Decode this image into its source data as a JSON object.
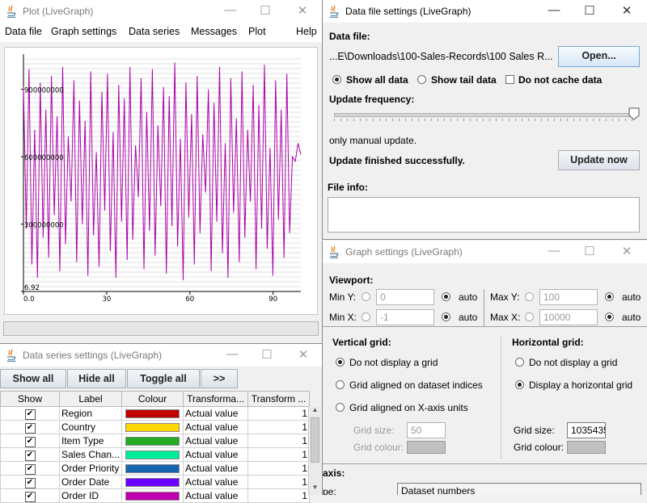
{
  "plot_window": {
    "title": "Plot (LiveGraph)",
    "menu": [
      "Data file",
      "Graph settings",
      "Data series",
      "Messages",
      "Plot",
      "Help"
    ],
    "y_tick_labels": [
      "900000000",
      "600000000",
      "300000000",
      "6.92"
    ],
    "x_tick_labels": [
      "0.0",
      "30",
      "60",
      "90"
    ],
    "line_color": "#aa00aa"
  },
  "chart_data": {
    "type": "line",
    "xlim": [
      0,
      100
    ],
    "ylim": [
      6.92,
      1035435000
    ],
    "y_ticks": [
      900000000,
      600000000,
      300000000,
      6.92
    ],
    "x_ticks": [
      0,
      30,
      60,
      90
    ],
    "grid": "horizontal",
    "series": [
      {
        "values": [
          910000000,
          280000000,
          990000000,
          120000000,
          720000000,
          60000000,
          930000000,
          240000000,
          810000000,
          150000000,
          960000000,
          340000000,
          780000000,
          90000000,
          1000000000,
          210000000,
          690000000,
          400000000,
          940000000,
          130000000,
          850000000,
          300000000,
          760000000,
          70000000,
          980000000,
          250000000,
          620000000,
          110000000,
          890000000,
          360000000,
          970000000,
          180000000,
          710000000,
          60000000,
          920000000,
          310000000,
          860000000,
          140000000,
          1000000000,
          230000000,
          650000000,
          420000000,
          950000000,
          100000000,
          800000000,
          270000000,
          990000000,
          160000000,
          740000000,
          380000000,
          910000000,
          80000000,
          870000000,
          290000000,
          1020000000,
          200000000,
          680000000,
          50000000,
          930000000,
          330000000,
          790000000,
          120000000,
          960000000,
          260000000,
          700000000,
          440000000,
          900000000,
          90000000,
          840000000,
          310000000,
          1000000000,
          170000000,
          660000000,
          60000000,
          950000000,
          350000000,
          770000000,
          130000000,
          980000000,
          240000000,
          720000000,
          400000000,
          920000000,
          100000000,
          830000000,
          280000000,
          1010000000,
          190000000,
          640000000,
          70000000,
          940000000,
          320000000,
          810000000,
          150000000,
          970000000,
          260000000,
          600000000,
          580000000,
          660000000,
          610000000
        ]
      }
    ]
  },
  "data_file_window": {
    "title": "Data file settings (LiveGraph)",
    "data_file_label": "Data file:",
    "file_path": "...E\\Downloads\\100-Sales-Records\\100 Sales R...",
    "open_button": "Open...",
    "show_all": "Show all data",
    "show_tail": "Show tail data",
    "no_cache": "Do not cache data",
    "update_freq_label": "Update frequency:",
    "update_mode": "only manual update.",
    "status": "Update finished successfully.",
    "update_button": "Update now",
    "file_info_label": "File info:",
    "slider_value_fraction": 1.0
  },
  "graph_settings_window": {
    "title": "Graph settings (LiveGraph)",
    "viewport_label": "Viewport:",
    "min_y_label": "Min Y:",
    "min_y_value": "0",
    "max_y_label": "Max Y:",
    "max_y_value": "100",
    "min_x_label": "Min X:",
    "min_x_value": "-1",
    "max_x_label": "Max X:",
    "max_x_value": "10000",
    "auto": "auto",
    "vertical_grid_label": "Vertical grid:",
    "v_opt_none": "Do not display a grid",
    "v_opt_indices": "Grid aligned on dataset indices",
    "v_opt_units": "Grid aligned on X-axis units",
    "v_grid_size_label": "Grid size:",
    "v_grid_size": "50",
    "v_grid_colour_label": "Grid colour:",
    "horizontal_grid_label": "Horizontal grid:",
    "h_opt_none": "Do not display a grid",
    "h_opt_display": "Display a horizontal grid",
    "h_grid_size_label": "Grid size:",
    "h_grid_size": "1035435",
    "h_grid_colour_label": "Grid colour:",
    "x_axis_label": "axis:",
    "x_axis_prefix": "pe:",
    "x_axis_value": "Dataset numbers"
  },
  "data_series_window": {
    "title": "Data series settings (LiveGraph)",
    "buttons": [
      "Show all",
      "Hide all",
      "Toggle all",
      ">>"
    ],
    "columns": [
      "Show",
      "Label",
      "Colour",
      "Transforma...",
      "Transform ..."
    ],
    "rows": [
      {
        "label": "Region",
        "colour": "#c00000",
        "transform": "Actual value",
        "param": "1"
      },
      {
        "label": "Country",
        "colour": "#ffd700",
        "transform": "Actual value",
        "param": "1"
      },
      {
        "label": "Item Type",
        "colour": "#22aa22",
        "transform": "Actual value",
        "param": "1"
      },
      {
        "label": "Sales Chan...",
        "colour": "#00ee99",
        "transform": "Actual value",
        "param": "1"
      },
      {
        "label": "Order Priority",
        "colour": "#1565b0",
        "transform": "Actual value",
        "param": "1"
      },
      {
        "label": "Order Date",
        "colour": "#6a00ff",
        "transform": "Actual value",
        "param": "1"
      },
      {
        "label": "Order ID",
        "colour": "#c000b0",
        "transform": "Actual value",
        "param": "1"
      }
    ]
  }
}
